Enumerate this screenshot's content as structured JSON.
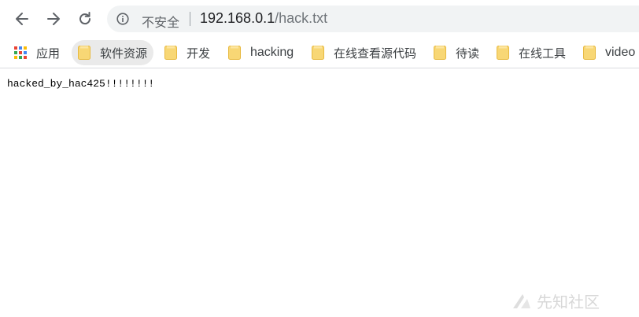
{
  "browser": {
    "security_label": "不安全",
    "url_host": "192.168.0.1",
    "url_path": "/hack.txt",
    "icons": [
      "back-icon",
      "forward-icon",
      "reload-icon",
      "info-icon",
      "apps-grid-icon",
      "folder-icon"
    ]
  },
  "bookmarks": {
    "apps_label": "应用",
    "items": [
      {
        "label": "软件资源"
      },
      {
        "label": "开发"
      },
      {
        "label": "hacking"
      },
      {
        "label": "在线查看源代码"
      },
      {
        "label": "待读"
      },
      {
        "label": "在线工具"
      },
      {
        "label": "video"
      }
    ]
  },
  "page": {
    "text": "hacked_by_hac425!!!!!!!!"
  },
  "watermark": {
    "text": "先知社区"
  },
  "colors": {
    "folder": "#f8d775",
    "text": "#000000",
    "omnibox_bg": "#f1f3f4",
    "icon": "#5f6368"
  }
}
